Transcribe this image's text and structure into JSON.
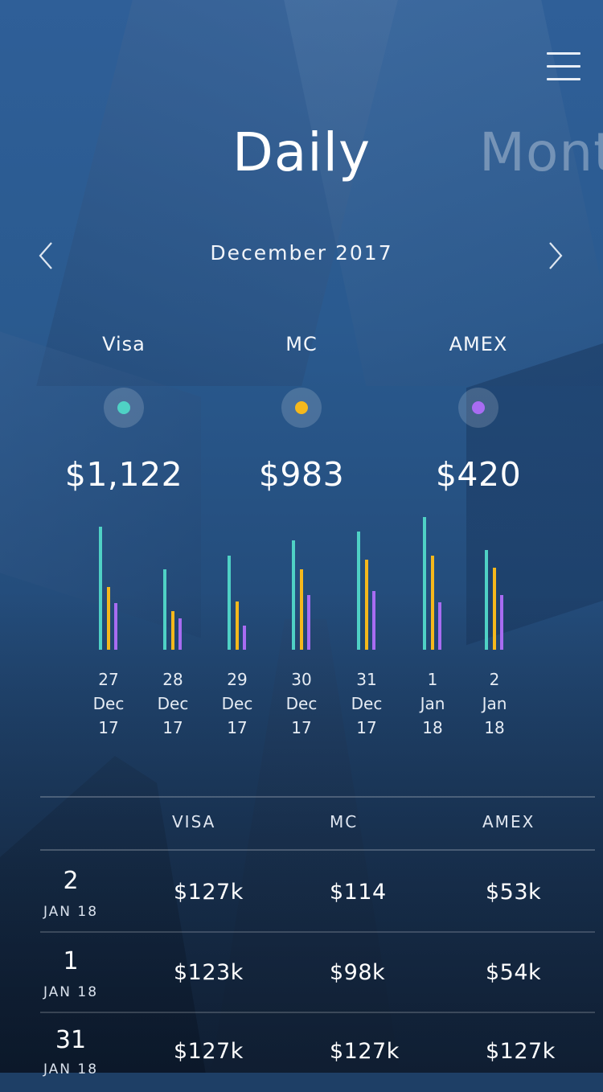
{
  "header": {
    "tabs": [
      {
        "label": "Daily",
        "active": true
      },
      {
        "label": "Month",
        "active": false
      }
    ],
    "menu_icon": "hamburger-icon"
  },
  "period": {
    "label": "December 2017",
    "prev_icon": "chevron-left-icon",
    "next_icon": "chevron-right-icon"
  },
  "cards": [
    {
      "name": "Visa",
      "amount": "$1,122",
      "color": "#4fd1c5"
    },
    {
      "name": "MC",
      "amount": "$983",
      "color": "#f5b81c"
    },
    {
      "name": "AMEX",
      "amount": "$420",
      "color": "#a86cf2"
    }
  ],
  "chart_data": {
    "type": "bar",
    "categories": [
      {
        "day": "27",
        "month": "Dec",
        "year": "17"
      },
      {
        "day": "28",
        "month": "Dec",
        "year": "17"
      },
      {
        "day": "29",
        "month": "Dec",
        "year": "17"
      },
      {
        "day": "30",
        "month": "Dec",
        "year": "17"
      },
      {
        "day": "31",
        "month": "Dec",
        "year": "17"
      },
      {
        "day": "1",
        "month": "Jan",
        "year": "18"
      },
      {
        "day": "2",
        "month": "Jan",
        "year": "18"
      }
    ],
    "series": [
      {
        "name": "Visa",
        "color": "#4fd1c5",
        "values": [
          132,
          86,
          101,
          117,
          127,
          142,
          107
        ]
      },
      {
        "name": "MC",
        "color": "#f5b81c",
        "values": [
          67,
          41,
          52,
          86,
          97,
          101,
          88
        ]
      },
      {
        "name": "AMEX",
        "color": "#a86cf2",
        "values": [
          50,
          34,
          26,
          59,
          63,
          51,
          59
        ]
      }
    ]
  },
  "table": {
    "headers": [
      "VISA",
      "MC",
      "AMEX"
    ],
    "rows": [
      {
        "day": "2",
        "month": "JAN 18",
        "visa": "$127k",
        "mc": "$114",
        "amex": "$53k"
      },
      {
        "day": "1",
        "month": "JAN 18",
        "visa": "$123k",
        "mc": "$98k",
        "amex": "$54k"
      },
      {
        "day": "31",
        "month": "JAN 18",
        "visa": "$127k",
        "mc": "$127k",
        "amex": "$127k"
      }
    ]
  }
}
